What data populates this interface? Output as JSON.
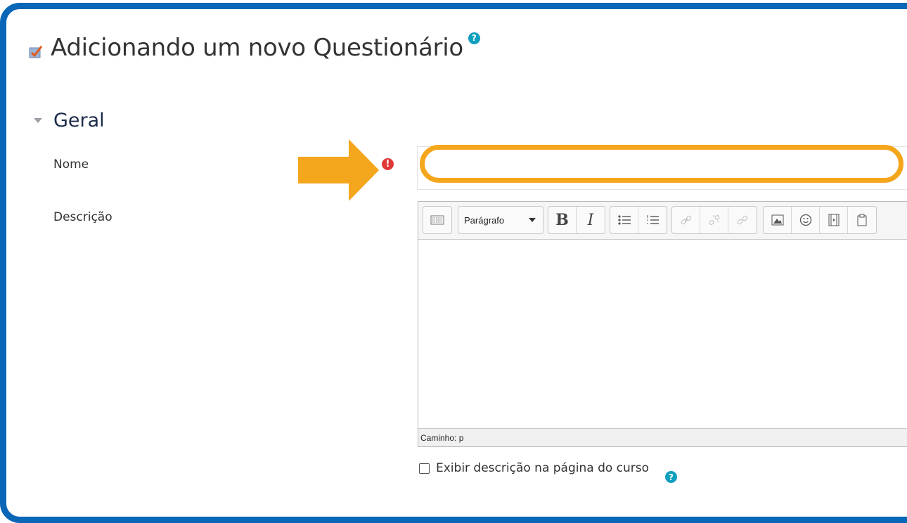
{
  "page": {
    "title": "Adicionando um novo Questionário",
    "title_icon": "quiz-icon",
    "help_glyph": "?"
  },
  "section": {
    "title": "Geral"
  },
  "form": {
    "name_label": "Nome",
    "name_value": "",
    "required_glyph": "!",
    "description_label": "Descrição",
    "show_description_label": "Exibir descrição na página do curso",
    "show_description_checked": false
  },
  "editor": {
    "paragraph_label": "Parágrafo",
    "bold_label": "B",
    "italic_label": "I",
    "body_text": "",
    "path_label": "Caminho: p"
  },
  "colors": {
    "frame": "#0a66b7",
    "highlight": "#f4a61c",
    "required": "#e03838",
    "help": "#0f9fbf"
  }
}
